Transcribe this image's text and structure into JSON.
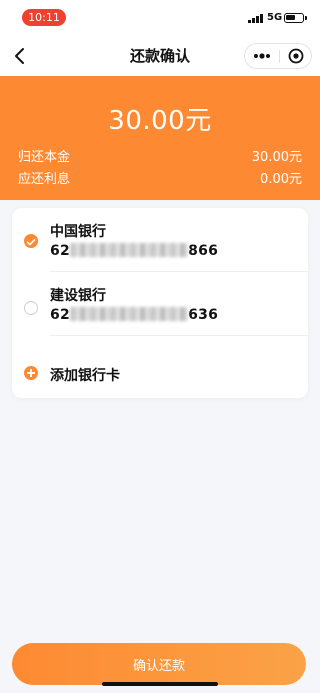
{
  "status_bar": {
    "time": "10:11",
    "network": "5G"
  },
  "nav": {
    "title": "还款确认"
  },
  "summary": {
    "amount": "30.00元",
    "principal_label": "归还本金",
    "principal_value": "30.00元",
    "interest_label": "应还利息",
    "interest_value": "0.00元"
  },
  "cards": [
    {
      "bank": "中国银行",
      "num_prefix": "62",
      "num_suffix": "866",
      "selected": true
    },
    {
      "bank": "建设银行",
      "num_prefix": "62",
      "num_suffix": "636",
      "selected": false
    }
  ],
  "add_card_label": "添加银行卡",
  "confirm_label": "确认还款",
  "colors": {
    "accent": "#fd8a33",
    "time_pill": "#f0412f",
    "background": "#f5f6fa"
  }
}
